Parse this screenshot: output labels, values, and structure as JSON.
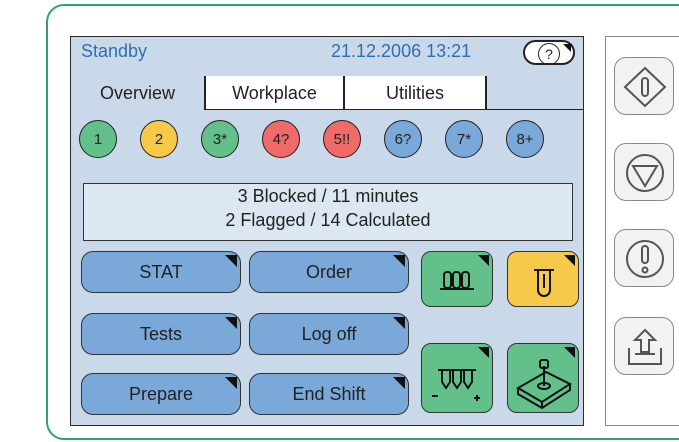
{
  "header": {
    "status": "Standby",
    "datetime": "21.12.2006 13:21",
    "help_label": "?"
  },
  "tabs": [
    {
      "label": "Overview",
      "active": true
    },
    {
      "label": "Workplace",
      "active": false
    },
    {
      "label": "Utilities",
      "active": false
    }
  ],
  "status_circles": [
    {
      "label": "1",
      "color": "#63c08a"
    },
    {
      "label": "2",
      "color": "#f6c94a"
    },
    {
      "label": "3*",
      "color": "#63c08a"
    },
    {
      "label": "4?",
      "color": "#f06a6a"
    },
    {
      "label": "5!!",
      "color": "#f06a6a"
    },
    {
      "label": "6?",
      "color": "#7aa9d9"
    },
    {
      "label": "7*",
      "color": "#7aa9d9"
    },
    {
      "label": "8+",
      "color": "#7aa9d9"
    }
  ],
  "info": {
    "line1": "3 Blocked / 11 minutes",
    "line2": "2 Flagged / 14 Calculated"
  },
  "buttons": {
    "stat": "STAT",
    "order": "Order",
    "tests": "Tests",
    "log_off": "Log off",
    "prepare": "Prepare",
    "end_shift": "End Shift"
  },
  "tiles": [
    {
      "icon": "rack-icon",
      "color": "#63c08a"
    },
    {
      "icon": "tube-icon",
      "color": "#f6c94a"
    },
    {
      "icon": "rack-load-unload-icon",
      "color": "#63c08a"
    },
    {
      "icon": "joystick-icon",
      "color": "#63c08a"
    }
  ],
  "side_buttons": [
    {
      "icon": "start-icon"
    },
    {
      "icon": "stop-icon"
    },
    {
      "icon": "alert-icon"
    },
    {
      "icon": "upload-icon"
    }
  ],
  "colors": {
    "screen_bg": "#c9d9e9",
    "button_blue": "#7aa9d9",
    "tile_green": "#63c08a",
    "tile_yellow": "#f6c94a",
    "device_border": "#2ea36a"
  }
}
